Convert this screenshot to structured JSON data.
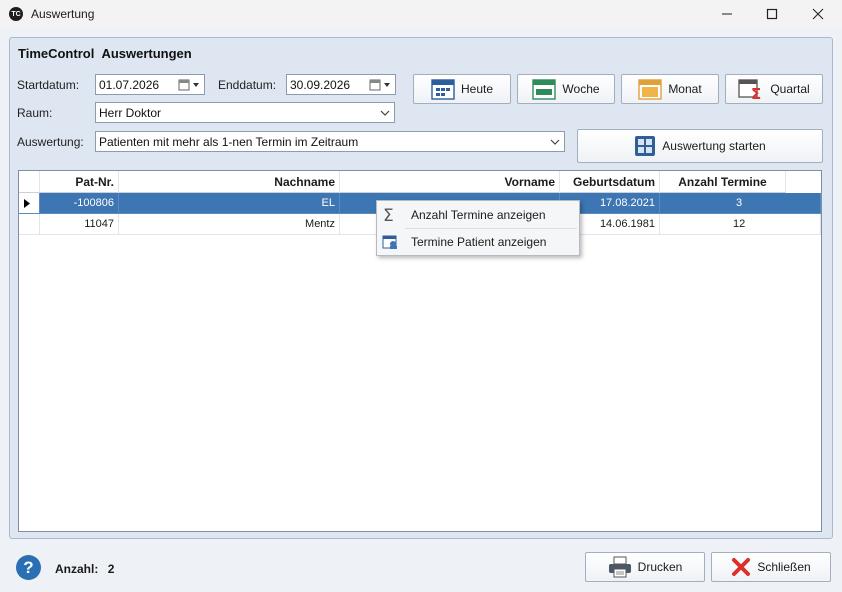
{
  "window": {
    "title": "Auswertung",
    "logo_text": "TC"
  },
  "panel": {
    "title": "TimeControl  Auswertungen"
  },
  "form": {
    "start_label": "Startdatum:",
    "start_value": "01.07.2026",
    "end_label": "Enddatum:",
    "end_value": "30.09.2026",
    "room_label": "Raum:",
    "room_value": "Herr Doktor",
    "eval_label": "Auswertung:",
    "eval_value": "Patienten mit mehr als 1-nen Termin im Zeitraum"
  },
  "quick_buttons": {
    "today": "Heute",
    "week": "Woche",
    "month": "Monat",
    "quarter": "Quartal"
  },
  "start_button": "Auswertung starten",
  "table": {
    "columns": [
      "Pat-Nr.",
      "Nachname",
      "Vorname",
      "Geburtsdatum",
      "Anzahl Termine"
    ],
    "rows": [
      [
        "-100806",
        "EL",
        "",
        "17.08.2021",
        "3"
      ],
      [
        "11047",
        "Mentz",
        "",
        "14.06.1981",
        "12"
      ]
    ]
  },
  "context_menu": {
    "item1": "Anzahl Termine anzeigen",
    "item2": "Termine Patient anzeigen"
  },
  "footer": {
    "count_label": "Anzahl:",
    "count_value": "2",
    "print": "Drucken",
    "close": "Schließen"
  },
  "colors": {
    "selection": "#3d76b2",
    "panel": "#dde6f1",
    "help": "#2a6eb3",
    "close_x": "#d9322a"
  }
}
